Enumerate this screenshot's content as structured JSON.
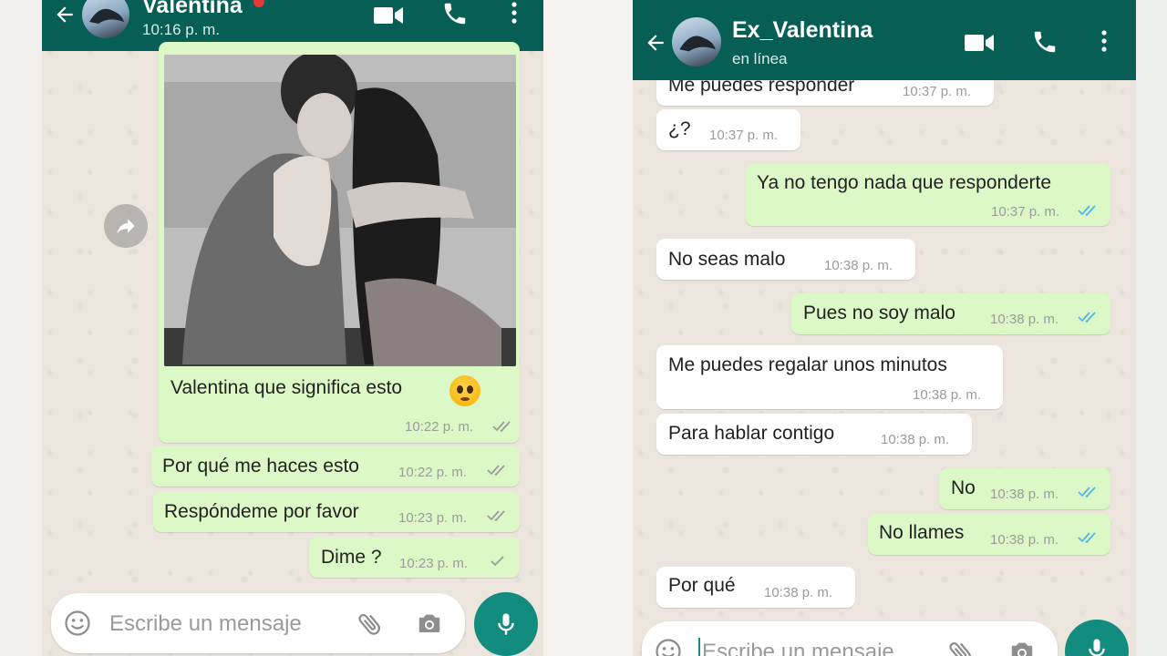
{
  "left_chat": {
    "header": {
      "contact_name": "Valentina",
      "subtitle": "10:16 p. m."
    },
    "photo_caption": "Valentina que significa esto",
    "photo_time": "10:22 p. m.",
    "messages": [
      {
        "text": "Por qué me haces esto",
        "time": "10:22 p. m.",
        "status": "double-tick"
      },
      {
        "text": "Respóndeme por favor",
        "time": "10:23 p. m.",
        "status": "double-tick"
      },
      {
        "text": "Dime ?",
        "time": "10:23 p. m.",
        "status": "single-tick"
      }
    ],
    "input_placeholder": "Escribe un mensaje"
  },
  "right_chat": {
    "header": {
      "contact_name": "Ex_Valentina",
      "subtitle": "en línea"
    },
    "messages": [
      {
        "direction": "in",
        "text": "Me puedes responder",
        "time": "10:37 p. m."
      },
      {
        "direction": "in",
        "text": "¿?",
        "time": "10:37 p. m."
      },
      {
        "direction": "out",
        "text": "Ya no tengo nada que responderte",
        "time": "10:37 p. m.",
        "status": "read"
      },
      {
        "direction": "in",
        "text": "No seas malo",
        "time": "10:38 p. m."
      },
      {
        "direction": "out",
        "text": "Pues no soy malo",
        "time": "10:38 p. m.",
        "status": "read"
      },
      {
        "direction": "in",
        "text": "Me puedes regalar unos minutos",
        "time": "10:38 p. m."
      },
      {
        "direction": "in",
        "text": "Para hablar contigo",
        "time": "10:38 p. m."
      },
      {
        "direction": "out",
        "text": "No",
        "time": "10:38 p. m.",
        "status": "read"
      },
      {
        "direction": "out",
        "text": "No llames",
        "time": "10:38 p. m.",
        "status": "read"
      },
      {
        "direction": "in",
        "text": "Por qué",
        "time": "10:38 p. m."
      }
    ],
    "input_placeholder": "Escribe un mensaje"
  },
  "colors": {
    "header": "#075e54",
    "accent": "#128c7e",
    "outgoing_bubble": "#dcf8c6",
    "incoming_bubble": "#ffffff",
    "chat_background": "#ece5dd",
    "read_ticks": "#4fb6ec",
    "sent_ticks": "#9b9b9b"
  },
  "icons": {
    "back": "back-arrow-icon",
    "video_call": "video-camera-icon",
    "voice_call": "phone-icon",
    "menu": "more-vertical-icon",
    "emoji": "emoji-icon",
    "attach": "paperclip-icon",
    "camera": "camera-icon",
    "mic": "microphone-icon",
    "forward": "forward-icon"
  }
}
